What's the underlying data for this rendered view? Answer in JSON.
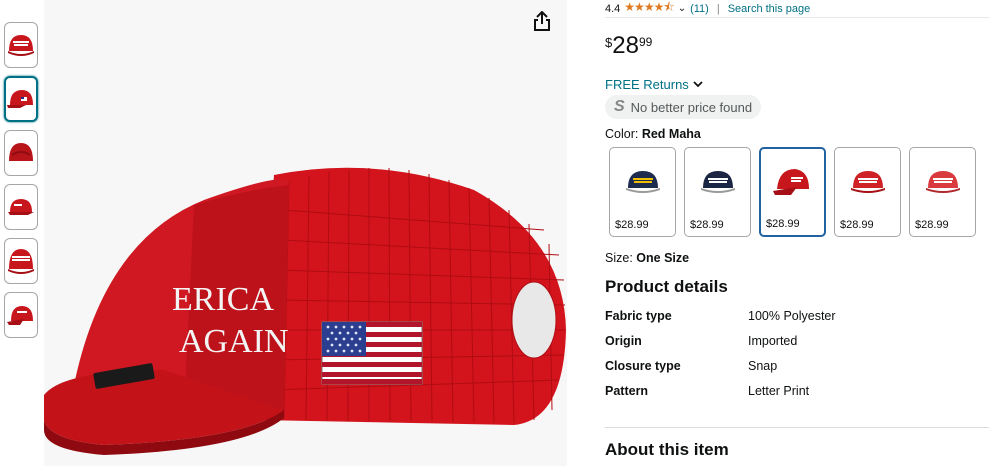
{
  "rating": {
    "value": "4.4",
    "stars": "★★★★⯪",
    "count": "(11)",
    "search_link": "Search this page"
  },
  "price": {
    "symbol": "$",
    "whole": "28",
    "fraction": "99"
  },
  "returns": {
    "label": "FREE Returns"
  },
  "price_badge": {
    "icon": "S",
    "label": "No better price found"
  },
  "color": {
    "label": "Color:",
    "value": "Red Maha"
  },
  "swatches": [
    {
      "price": "$28.99",
      "cap_color": "#1d2b4f",
      "text_color": "#f0c000",
      "selected": false
    },
    {
      "price": "$28.99",
      "cap_color": "#1b2644",
      "text_color": "#ffffff",
      "selected": false
    },
    {
      "price": "$28.99",
      "cap_color": "#c8161d",
      "text_color": "#ffffff",
      "selected": true
    },
    {
      "price": "$28.99",
      "cap_color": "#cf2226",
      "text_color": "#ffffff",
      "selected": false
    },
    {
      "price": "$28.99",
      "cap_color": "#d93a3e",
      "text_color": "#ffffff",
      "selected": false
    }
  ],
  "size": {
    "label": "Size:",
    "value": "One Size"
  },
  "product_details": {
    "title": "Product details",
    "rows": [
      {
        "key": "Fabric type",
        "value": "100% Polyester"
      },
      {
        "key": "Origin",
        "value": "Imported"
      },
      {
        "key": "Closure type",
        "value": "Snap"
      },
      {
        "key": "Pattern",
        "value": "Letter Print"
      }
    ]
  },
  "about": {
    "title": "About this item"
  },
  "main_image": {
    "cap_text_line1": "ERICA",
    "cap_text_line2": "AGAIN"
  },
  "colors": {
    "link": "#007185",
    "star": "#de7921",
    "cap_red": "#c8161d",
    "selected_border": "#2162a1"
  }
}
